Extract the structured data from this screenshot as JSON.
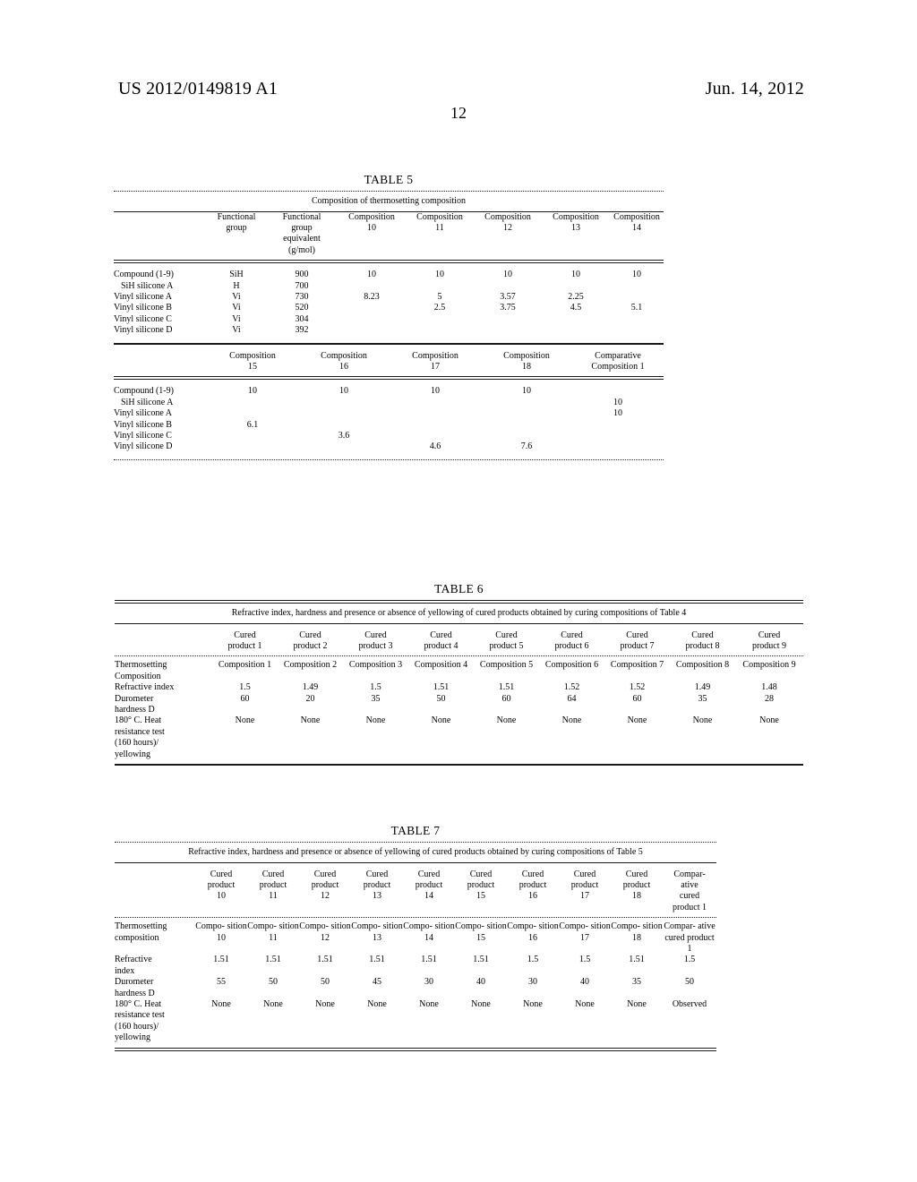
{
  "runhead": {
    "publication": "US 2012/0149819 A1",
    "date": "Jun. 14, 2012",
    "page_number": "12"
  },
  "table5": {
    "title": "TABLE 5",
    "caption": "Composition of thermosetting composition",
    "block1": {
      "headers": [
        "",
        "Functional\ngroup",
        "Functional\ngroup\nequivalent\n(g/mol)",
        "Composition\n10",
        "Composition\n11",
        "Composition\n12",
        "Composition\n13",
        "Composition\n14"
      ],
      "rows": [
        {
          "label": "Compound (1-9)",
          "indent": false,
          "cells": [
            "SiH",
            "900",
            "10",
            "10",
            "10",
            "10",
            "10"
          ]
        },
        {
          "label": "SiH silicone A",
          "indent": true,
          "cells": [
            "H",
            "700",
            "",
            "",
            "",
            "",
            ""
          ]
        },
        {
          "label": "Vinyl silicone A",
          "indent": false,
          "cells": [
            "Vi",
            "730",
            "8.23",
            "5",
            "3.57",
            "2.25",
            ""
          ]
        },
        {
          "label": "Vinyl silicone B",
          "indent": false,
          "cells": [
            "Vi",
            "520",
            "",
            "2.5",
            "3.75",
            "4.5",
            "5.1"
          ]
        },
        {
          "label": "Vinyl silicone C",
          "indent": false,
          "cells": [
            "Vi",
            "304",
            "",
            "",
            "",
            "",
            ""
          ]
        },
        {
          "label": "Vinyl silicone D",
          "indent": false,
          "cells": [
            "Vi",
            "392",
            "",
            "",
            "",
            "",
            ""
          ]
        }
      ]
    },
    "block2": {
      "headers": [
        "",
        "Composition\n15",
        "Composition\n16",
        "Composition\n17",
        "Composition\n18",
        "Comparative\nComposition 1"
      ],
      "rows": [
        {
          "label": "Compound (1-9)",
          "indent": false,
          "cells": [
            "10",
            "10",
            "10",
            "10",
            ""
          ]
        },
        {
          "label": "SiH silicone A",
          "indent": true,
          "cells": [
            "",
            "",
            "",
            "",
            "10"
          ]
        },
        {
          "label": "Vinyl silicone A",
          "indent": false,
          "cells": [
            "",
            "",
            "",
            "",
            "10"
          ]
        },
        {
          "label": "Vinyl silicone B",
          "indent": false,
          "cells": [
            "6.1",
            "",
            "",
            "",
            ""
          ]
        },
        {
          "label": "Vinyl silicone C",
          "indent": false,
          "cells": [
            "",
            "3.6",
            "",
            "",
            ""
          ]
        },
        {
          "label": "Vinyl silicone D",
          "indent": false,
          "cells": [
            "",
            "",
            "4.6",
            "7.6",
            ""
          ]
        }
      ]
    }
  },
  "table6": {
    "title": "TABLE 6",
    "caption": "Refractive index, hardness and presence or absence of yellowing of cured products obtained\nby curing compositions of Table 4",
    "headers": [
      "",
      "Cured\nproduct 1",
      "Cured\nproduct 2",
      "Cured\nproduct 3",
      "Cured\nproduct 4",
      "Cured\nproduct 5",
      "Cured\nproduct 6",
      "Cured\nproduct 7",
      "Cured\nproduct 8",
      "Cured\nproduct 9"
    ],
    "rows": [
      {
        "label": "Thermosetting\nComposition",
        "cells": [
          "Composition\n1",
          "Composition\n2",
          "Composition\n3",
          "Composition\n4",
          "Composition\n5",
          "Composition\n6",
          "Composition\n7",
          "Composition\n8",
          "Composition\n9"
        ]
      },
      {
        "label": "Refractive index",
        "cells": [
          "1.5",
          "1.49",
          "1.5",
          "1.51",
          "1.51",
          "1.52",
          "1.52",
          "1.49",
          "1.48"
        ]
      },
      {
        "label": "Durometer\nhardness D",
        "cells": [
          "60",
          "20",
          "35",
          "50",
          "60",
          "64",
          "60",
          "35",
          "28"
        ]
      },
      {
        "label": "180° C. Heat\nresistance test\n(160 hours)/\nyellowing",
        "cells": [
          "None",
          "None",
          "None",
          "None",
          "None",
          "None",
          "None",
          "None",
          "None"
        ]
      }
    ]
  },
  "table7": {
    "title": "TABLE 7",
    "caption": "Refractive index, hardness and presence or absence of yellowing of cured products obtained\nby curing compositions of Table 5",
    "headers": [
      "",
      "Cured\nproduct\n10",
      "Cured\nproduct\n11",
      "Cured\nproduct\n12",
      "Cured\nproduct\n13",
      "Cured\nproduct\n14",
      "Cured\nproduct\n15",
      "Cured\nproduct\n16",
      "Cured\nproduct\n17",
      "Cured\nproduct\n18",
      "Compar-\native\ncured\nproduct 1"
    ],
    "rows": [
      {
        "label": "Thermosetting\ncomposition",
        "cells": [
          "Compo-\nsition\n10",
          "Compo-\nsition\n11",
          "Compo-\nsition\n12",
          "Compo-\nsition\n13",
          "Compo-\nsition\n14",
          "Compo-\nsition\n15",
          "Compo-\nsition\n16",
          "Compo-\nsition\n17",
          "Compo-\nsition\n18",
          "Compar-\native\ncured\nproduct 1"
        ]
      },
      {
        "label": "Refractive\nindex",
        "cells": [
          "1.51",
          "1.51",
          "1.51",
          "1.51",
          "1.51",
          "1.51",
          "1.5",
          "1.5",
          "1.51",
          "1.5"
        ]
      },
      {
        "label": "Durometer\nhardness D",
        "cells": [
          "55",
          "50",
          "50",
          "45",
          "30",
          "40",
          "30",
          "40",
          "35",
          "50"
        ]
      },
      {
        "label": "180° C. Heat\nresistance test\n(160 hours)/\nyellowing",
        "cells": [
          "None",
          "None",
          "None",
          "None",
          "None",
          "None",
          "None",
          "None",
          "None",
          "Observed"
        ]
      }
    ]
  }
}
